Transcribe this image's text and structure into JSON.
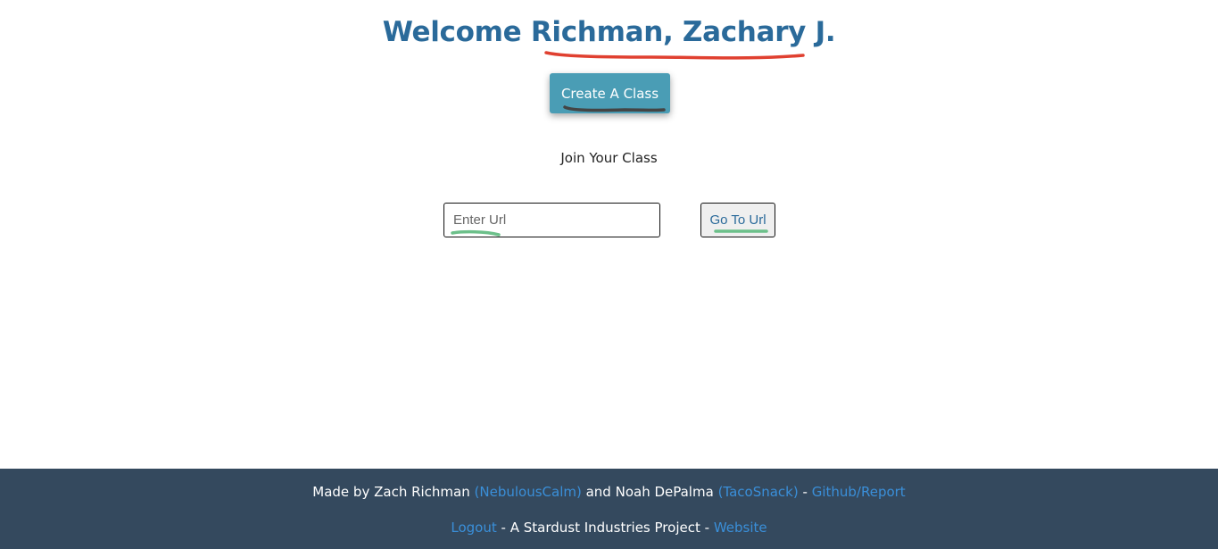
{
  "header": {
    "welcome_prefix": "Welcome",
    "user_name": "Richman, Zachary J."
  },
  "actions": {
    "create_class_label": "Create A Class"
  },
  "join": {
    "heading": "Join Your Class",
    "url_placeholder": "Enter Url",
    "url_value": "",
    "go_label": "Go To Url"
  },
  "footer": {
    "made_by": "Made by Zach Richman",
    "handle1": "(NebulousCalm)",
    "and_text": "and Noah DePalma",
    "handle2": "(TacoSnack)",
    "sep1": "-",
    "github_label": "Github/Report",
    "logout_label": "Logout",
    "project_text": "- A Stardust Industries Project -",
    "website_label": "Website"
  },
  "colors": {
    "title": "#2a6a9a",
    "create_button": "#4a9db5",
    "footer_bg": "#34495e",
    "link": "#3a8fd9",
    "scribble_red": "#e04030",
    "scribble_green": "#6cc08a",
    "scribble_dark": "#444444"
  }
}
